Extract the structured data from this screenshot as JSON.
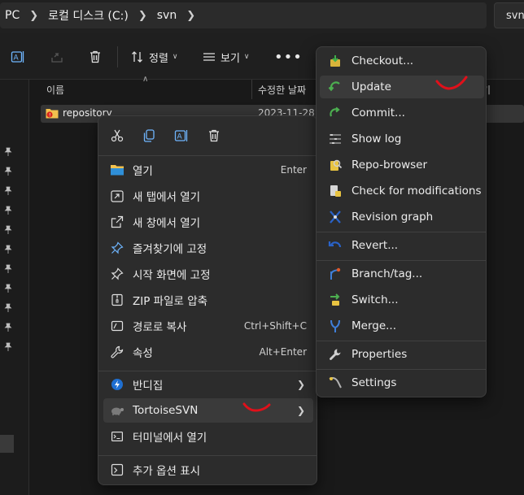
{
  "address_bar": {
    "crumbs": [
      "PC",
      "로컬 디스크 (C:)",
      "svn"
    ],
    "search_text": "svn"
  },
  "toolbar": {
    "sort_label": "정렬",
    "view_label": "보기",
    "more_label": "•••"
  },
  "file_list": {
    "col_name": "이름",
    "col_modified": "수정한 날짜",
    "col_type": "기",
    "rows": [
      {
        "name": "repository",
        "modified": "2023-11-28"
      }
    ]
  },
  "context_menu": {
    "items": [
      {
        "label": "열기",
        "shortcut": "Enter",
        "icon": "folder-open-icon"
      },
      {
        "label": "새 탭에서 열기",
        "icon": "new-tab-icon"
      },
      {
        "label": "새 창에서 열기",
        "icon": "new-window-icon"
      },
      {
        "label": "즐겨찾기에 고정",
        "icon": "pin-icon"
      },
      {
        "label": "시작 화면에 고정",
        "icon": "pin-start-icon"
      },
      {
        "label": "ZIP 파일로 압축",
        "icon": "zip-icon"
      },
      {
        "label": "경로로 복사",
        "shortcut": "Ctrl+Shift+C",
        "icon": "copy-path-icon"
      },
      {
        "label": "속성",
        "shortcut": "Alt+Enter",
        "icon": "wrench-icon"
      },
      {
        "label": "반디집",
        "icon": "bandizip-icon"
      },
      {
        "label": "TortoiseSVN",
        "icon": "tortoise-icon"
      },
      {
        "label": "터미널에서 열기",
        "icon": "terminal-icon"
      },
      {
        "label": "추가 옵션 표시",
        "icon": "more-options-icon"
      }
    ]
  },
  "svn_submenu": {
    "items": [
      {
        "label": "Checkout...",
        "icon": "checkout-icon"
      },
      {
        "label": "Update",
        "icon": "update-icon"
      },
      {
        "label": "Commit...",
        "icon": "commit-icon"
      },
      {
        "label": "Show log",
        "icon": "log-icon"
      },
      {
        "label": "Repo-browser",
        "icon": "repo-browser-icon"
      },
      {
        "label": "Check for modifications",
        "icon": "check-mods-icon"
      },
      {
        "label": "Revision graph",
        "icon": "revision-graph-icon"
      },
      {
        "label": "Revert...",
        "icon": "revert-icon"
      },
      {
        "label": "Branch/tag...",
        "icon": "branch-icon"
      },
      {
        "label": "Switch...",
        "icon": "switch-icon"
      },
      {
        "label": "Merge...",
        "icon": "merge-icon"
      },
      {
        "label": "Properties",
        "icon": "properties-icon"
      },
      {
        "label": "Settings",
        "icon": "settings-icon"
      }
    ]
  },
  "colors": {
    "annotation": "#e0101a",
    "menu_bg": "#2c2c2c",
    "highlight": "#3a3a3a"
  }
}
